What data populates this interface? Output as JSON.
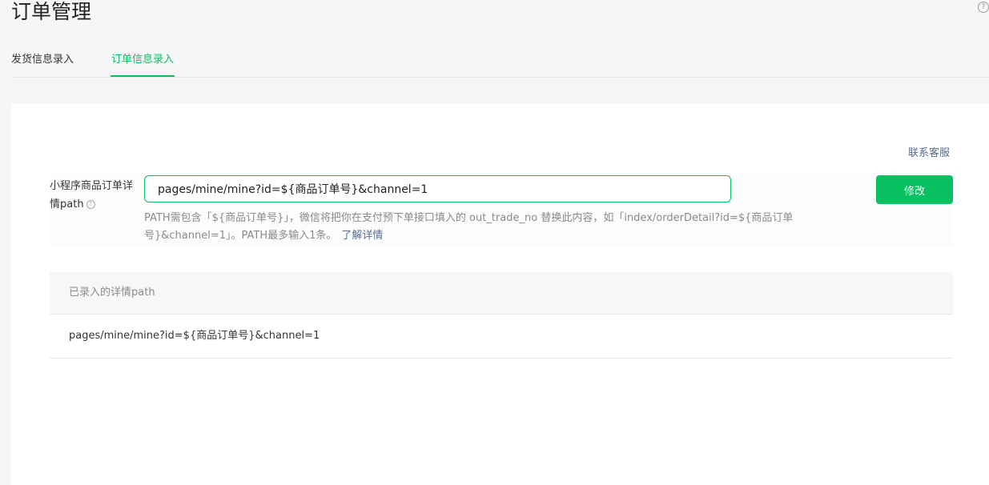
{
  "page": {
    "title": "订单管理",
    "help_symbol": "?"
  },
  "tabs": [
    {
      "label": "发货信息录入",
      "active": false
    },
    {
      "label": "订单信息录入",
      "active": true
    }
  ],
  "card": {
    "contact_link": "联系客服",
    "form": {
      "label": "小程序商品订单详情path",
      "label_help_symbol": "?",
      "input_value": "pages/mine/mine?id=${商品订单号}&channel=1",
      "modify_label": "修改",
      "tip_text": "PATH需包含「${商品订单号}」，微信将把你在支付预下单接口填入的 out_trade_no 替换此内容，如「index/orderDetail?id=${商品订单号}&channel=1」。PATH最多输入1条。",
      "learn_more": "了解详情"
    },
    "table": {
      "header": "已录入的详情path",
      "rows": [
        "pages/mine/mine?id=${商品订单号}&channel=1"
      ]
    }
  },
  "colors": {
    "accent": "#07c160",
    "link": "#576b95",
    "page_bg": "#f5f6f7"
  }
}
